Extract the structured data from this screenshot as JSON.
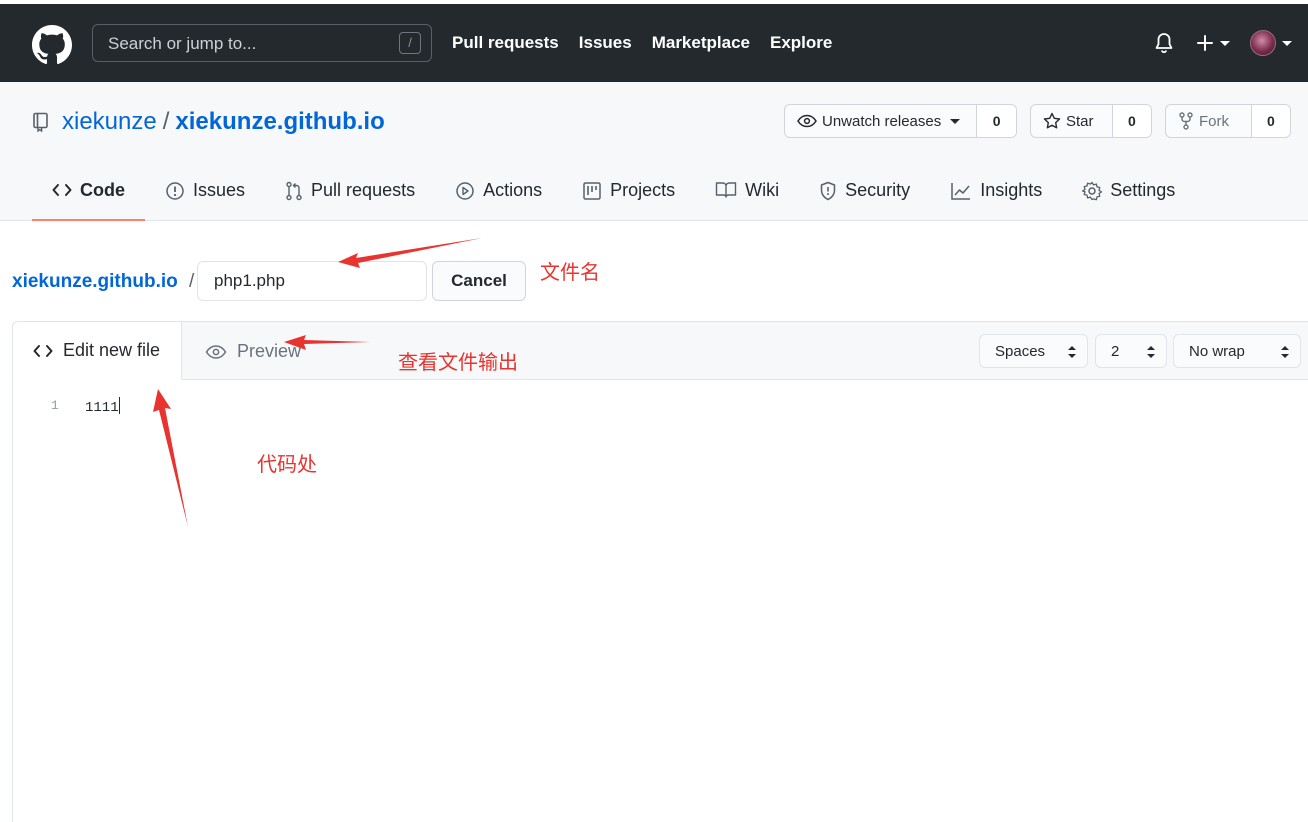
{
  "header": {
    "search_placeholder": "Search or jump to...",
    "search_shortcut": "/",
    "nav": [
      "Pull requests",
      "Issues",
      "Marketplace",
      "Explore"
    ]
  },
  "repo": {
    "owner": "xiekunze",
    "separator": "/",
    "name": "xiekunze.github.io",
    "watch_label": "Unwatch releases",
    "watch_count": "0",
    "star_label": "Star",
    "star_count": "0",
    "fork_label": "Fork",
    "fork_count": "0"
  },
  "tabs": [
    "Code",
    "Issues",
    "Pull requests",
    "Actions",
    "Projects",
    "Wiki",
    "Security",
    "Insights",
    "Settings"
  ],
  "breadcrumb": {
    "repo": "xiekunze.github.io",
    "separator": "/"
  },
  "filename": {
    "value": "php1.php"
  },
  "cancel_label": "Cancel",
  "editor": {
    "edit_tab": "Edit new file",
    "preview_tab": "Preview",
    "indent_mode": "Spaces",
    "indent_size": "2",
    "wrap_mode": "No wrap",
    "line_number": "1",
    "code": "1111"
  },
  "annotations": {
    "filename_note": "文件名",
    "preview_note": "查看文件输出",
    "code_note": "代码处",
    "color": "#e8342f"
  },
  "colors": {
    "header_bg": "#24292e",
    "link": "#0366d6",
    "active_tab_underline": "#f9826c"
  }
}
